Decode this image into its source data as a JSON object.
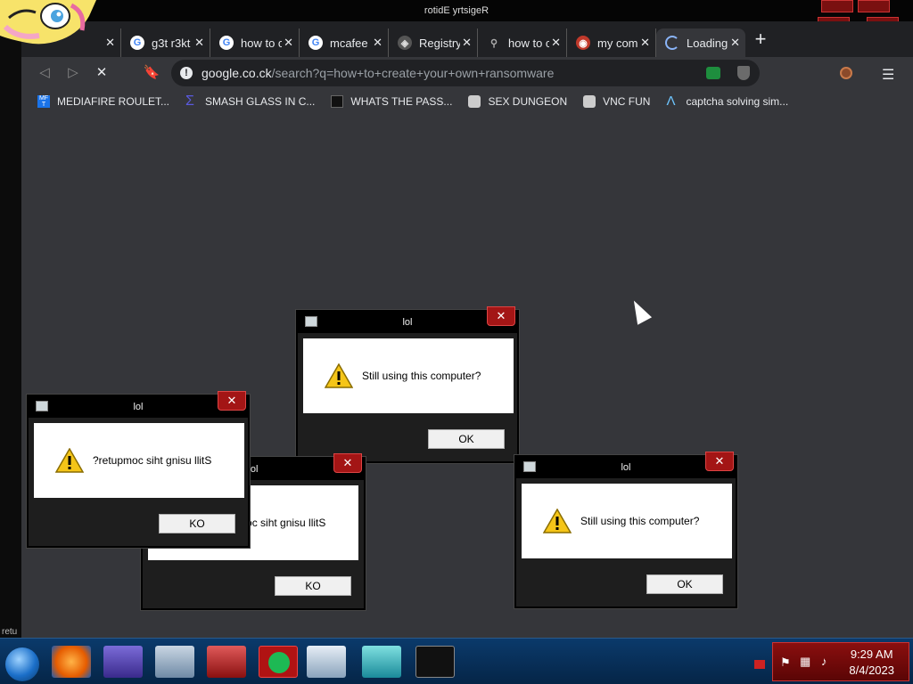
{
  "registry_window": {
    "title": "rotidE yrtsigeR"
  },
  "browser": {
    "tabs": [
      {
        "label": "",
        "icon": "google-icon"
      },
      {
        "label": "g3t r3kt",
        "icon": "google-icon"
      },
      {
        "label": "how to c",
        "icon": "google-icon"
      },
      {
        "label": "mcafee",
        "icon": "google-icon"
      },
      {
        "label": "Registry",
        "icon": "site-icon"
      },
      {
        "label": "how to c",
        "icon": "site-icon"
      },
      {
        "label": "my com",
        "icon": "site-icon"
      },
      {
        "label": "Loading",
        "icon": "spinner-icon"
      }
    ],
    "address": {
      "host": "google.co.ck",
      "path": "/search?q=how+to+create+your+own+ransomware"
    },
    "bookmarks": [
      {
        "label": "MEDIAFIRE ROULET...",
        "icon": "mediafire-icon",
        "color": "#1a73e8"
      },
      {
        "label": "SMASH GLASS IN C...",
        "icon": "sigma-icon",
        "color": "#5a5ae0"
      },
      {
        "label": "WHATS THE PASS...",
        "icon": "lock-icon",
        "color": "#111111"
      },
      {
        "label": "SEX DUNGEON",
        "icon": "robot-icon",
        "color": "#cccccc"
      },
      {
        "label": "VNC FUN",
        "icon": "robot-icon",
        "color": "#cccccc"
      },
      {
        "label": "captcha solving sim...",
        "icon": "lambda-icon",
        "color": "#6ec6ff"
      }
    ]
  },
  "dialogs": [
    {
      "title": "lol",
      "message": "Still using this computer?",
      "button": "OK"
    },
    {
      "title": "lol",
      "message": "?retupmoc siht gnisu llitS",
      "button": "KO"
    },
    {
      "title": "lol",
      "message": "?retupmoc siht gnisu llitS",
      "button": "KO"
    },
    {
      "title": "lol",
      "message": "Still using this computer?",
      "button": "OK"
    }
  ],
  "desktop_left_label": "retu",
  "taskbar": {
    "time": "9:29 AM",
    "date": "8/4/2023",
    "apps": [
      "firefox-icon",
      "toolbox-icon",
      "printer-icon",
      "monitor-icon",
      "briefcase-icon",
      "spotify-icon",
      "document-icon",
      "cubes-icon",
      "terminal-icon"
    ]
  },
  "colors": {
    "accent_red": "#a31515",
    "chrome_bg": "#35363a",
    "taskbar": "#052547"
  }
}
